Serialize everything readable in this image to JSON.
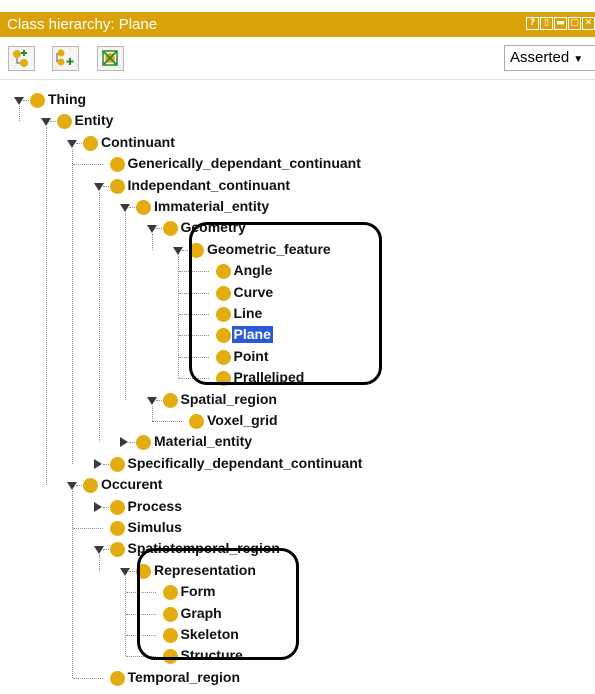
{
  "window": {
    "title": "Class hierarchy: Plane",
    "controls": [
      "?",
      "▯",
      "▬",
      "▢",
      "✕"
    ]
  },
  "toolbar": {
    "add_subclass_icon": "add-subclass-icon",
    "add_sibling_icon": "add-sibling-icon",
    "delete_class_icon": "delete-class-icon",
    "view_mode": "Asserted"
  },
  "colors": {
    "titlebar": "#d9a20a",
    "bullet": "#e3ad12",
    "selection": "#2a5bd7"
  },
  "tree": {
    "nodes": [
      {
        "label": "Thing",
        "expanded": true
      },
      {
        "label": "Entity",
        "expanded": true
      },
      {
        "label": "Continuant",
        "expanded": true
      },
      {
        "label": "Generically_dependant_continuant",
        "expanded": null
      },
      {
        "label": "Independant_continuant",
        "expanded": true
      },
      {
        "label": "Immaterial_entity",
        "expanded": true
      },
      {
        "label": "Geometry",
        "expanded": true
      },
      {
        "label": "Geometric_feature",
        "expanded": true
      },
      {
        "label": "Angle",
        "expanded": null
      },
      {
        "label": "Curve",
        "expanded": null
      },
      {
        "label": "Line",
        "expanded": null
      },
      {
        "label": "Plane",
        "expanded": null,
        "selected": true
      },
      {
        "label": "Point",
        "expanded": null
      },
      {
        "label": "Pralleliped",
        "expanded": null
      },
      {
        "label": "Spatial_region",
        "expanded": true
      },
      {
        "label": "Voxel_grid",
        "expanded": null
      },
      {
        "label": "Material_entity",
        "expanded": false
      },
      {
        "label": "Specifically_dependant_continuant",
        "expanded": false
      },
      {
        "label": "Occurent",
        "expanded": true
      },
      {
        "label": "Process",
        "expanded": false
      },
      {
        "label": "Simulus",
        "expanded": null
      },
      {
        "label": "Spatiotemporal_region",
        "expanded": true
      },
      {
        "label": "Representation",
        "expanded": true
      },
      {
        "label": "Form",
        "expanded": null
      },
      {
        "label": "Graph",
        "expanded": null
      },
      {
        "label": "Skeleton",
        "expanded": null
      },
      {
        "label": "Structure",
        "expanded": null
      },
      {
        "label": "Temporal_region",
        "expanded": null
      }
    ]
  }
}
